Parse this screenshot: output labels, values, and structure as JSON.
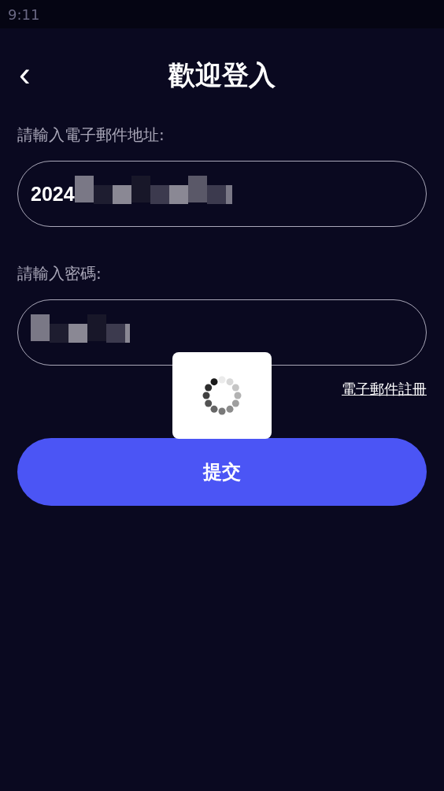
{
  "status_bar": {
    "time": "9:11"
  },
  "header": {
    "back": "‹",
    "title": "歡迎登入"
  },
  "email": {
    "label": "請輸入電子郵件地址:",
    "value": "2024",
    "redacted": true
  },
  "password": {
    "label": "請輸入密碼:",
    "redacted": true
  },
  "register_link": "電子郵件註冊",
  "submit": "提交",
  "loading": {
    "visible": true
  }
}
